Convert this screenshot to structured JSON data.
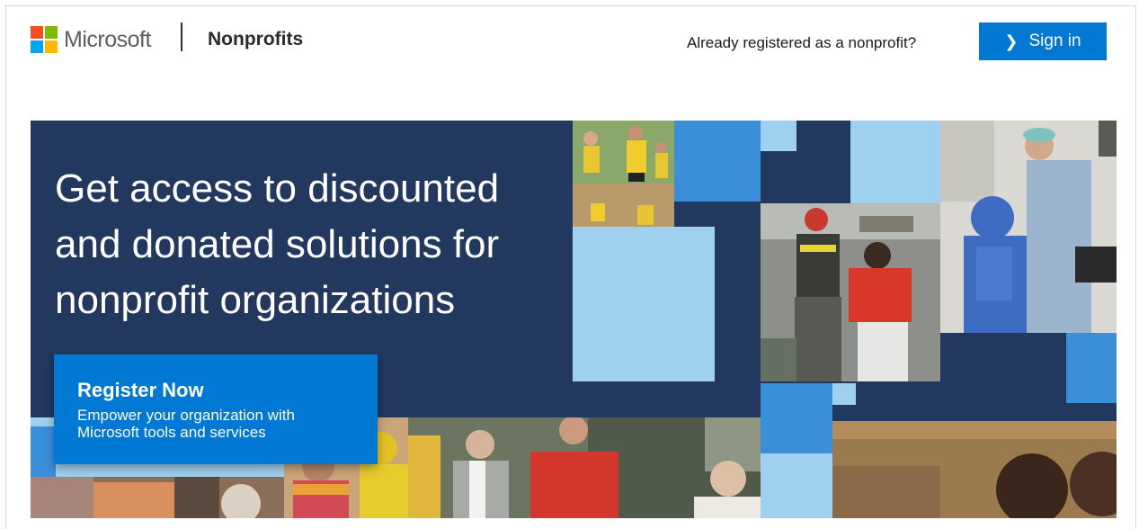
{
  "header": {
    "brand": "Microsoft",
    "section": "Nonprofits",
    "registered_prompt": "Already registered as a nonprofit?",
    "sign_in_label": "Sign in",
    "logo_colors": [
      "#f25022",
      "#7fba00",
      "#00a4ef",
      "#ffb900"
    ]
  },
  "hero": {
    "headline": "Get access to discounted and donated solutions for nonprofit organizations",
    "cta": {
      "title": "Register Now",
      "subtitle": "Empower your organization with Microsoft tools and services"
    }
  },
  "colors": {
    "accent": "#0078d4",
    "panel": "#22385e",
    "tile_light": "#9fd0ef",
    "tile_mid": "#3a8fd8"
  }
}
